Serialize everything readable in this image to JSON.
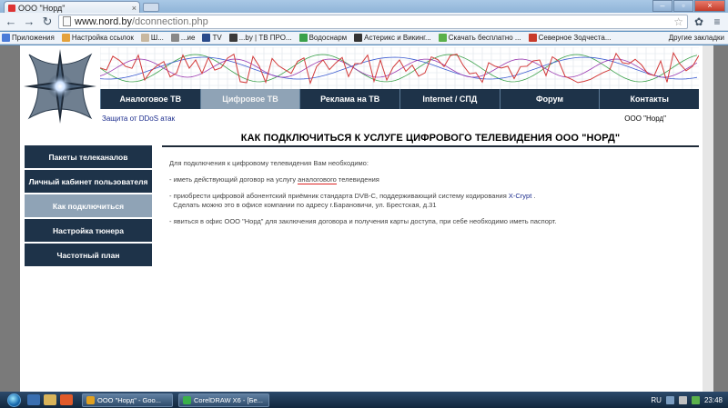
{
  "browser": {
    "tab_title": "ООО \"Норд\"",
    "url_host": "www.nord.by",
    "url_path": "/dconnection.php",
    "bookmarks": [
      {
        "label": "Приложения",
        "color": "#4a7bd8"
      },
      {
        "label": "Настройка ссылок",
        "color": "#e4a23c"
      },
      {
        "label": "Ш...",
        "color": "#c8b8a0"
      },
      {
        "label": "...ие",
        "color": "#888888"
      },
      {
        "label": "TV",
        "color": "#2a4a8a"
      },
      {
        "label": "...by | ТВ ПРО...",
        "color": "#3a3a3a"
      },
      {
        "label": "Водоснарм",
        "color": "#3aa04a"
      },
      {
        "label": "Астерикс и Викинг...",
        "color": "#333333"
      },
      {
        "label": "Скачать бесплатно ...",
        "color": "#5ab04a"
      },
      {
        "label": "Северное Зодчеста...",
        "color": "#c83a2a"
      }
    ],
    "other_bookmarks": "Другие закладки"
  },
  "site": {
    "nav": [
      "Аналоговое ТВ",
      "Цифровое ТВ",
      "Реклама на ТВ",
      "Internet / СПД",
      "Форум",
      "Контакты"
    ],
    "nav_active": 1,
    "ddos_link": "Защита от DDoS атак",
    "company": "ООО \"Норд\"",
    "headline": "КАК ПОДКЛЮЧИТЬСЯ К УСЛУГЕ ЦИФРОВОГО ТЕЛЕВИДЕНИЯ ООО \"НОРД\"",
    "sidemenu": [
      "Пакеты телеканалов",
      "Личный кабинет пользователя",
      "Как подключиться",
      "Настройка тюнера",
      "Частотный план"
    ],
    "sidemenu_active": 2,
    "content": {
      "intro": "Для подключения к цифровому телевидения Вам необходимо:",
      "item1_pre": "- иметь действующий договор на услугу ",
      "item1_ul": "аналогового",
      "item1_post": " телевидения",
      "item2_pre": "- приобрести цифровой абонентский приёмник стандарта DVB-C, поддерживающий систему кодирования ",
      "item2_hl": "X-Crypt",
      "item2_post": " .",
      "item2_line2": "Сделать можно это в офисе компании по адресу г.Барановичи, ул. Брестская, д.31",
      "item3": "- явиться в офис ООО \"Норд\" для заключения договора и получения карты доступа, при себе необходимо иметь паспорт."
    }
  },
  "taskbar": {
    "tasks": [
      {
        "label": "ООО \"Норд\" - Goo...",
        "color": "#e0a020"
      },
      {
        "label": "CorelDRAW X6 - [Бе...",
        "color": "#3ab04a"
      }
    ],
    "lang": "RU",
    "time": "23:48"
  },
  "colors": {
    "nav_bg": "#1e3349",
    "nav_active": "#8fa3b6",
    "link": "#1a2b8c",
    "underline": "#dd2222"
  }
}
